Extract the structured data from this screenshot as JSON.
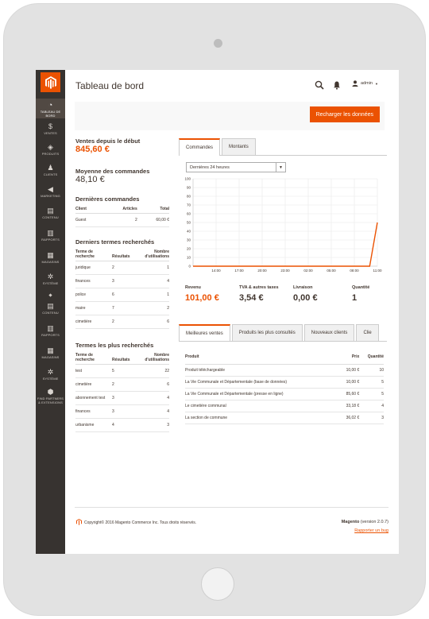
{
  "sidebar": {
    "items": [
      {
        "label": "TABLEAU DE BORD",
        "icon": "dashboard-icon",
        "active": true
      },
      {
        "label": "VENTES",
        "icon": "dollar-icon"
      },
      {
        "label": "PRODUITS",
        "icon": "cube-icon"
      },
      {
        "label": "CLIENTS",
        "icon": "person-icon"
      },
      {
        "label": "MARKETING",
        "icon": "megaphone-icon"
      },
      {
        "label": "CONTENU",
        "icon": "layout-icon"
      },
      {
        "label": "RAPPORTS",
        "icon": "bar-chart-icon"
      },
      {
        "label": "MAGASINS",
        "icon": "store-icon"
      },
      {
        "label": "SYSTÈME",
        "icon": "gear-icon"
      },
      {
        "label": "CONTENU",
        "icon": "layout-icon"
      },
      {
        "label": "RAPPORTS",
        "icon": "bar-chart-icon"
      },
      {
        "label": "MAGASINS",
        "icon": "store-icon"
      },
      {
        "label": "SYSTÈME",
        "icon": "gear-icon"
      },
      {
        "label": "FIND PARTNERS & EXTENSIONS",
        "icon": "box-icon"
      }
    ]
  },
  "header": {
    "title": "Tableau de bord",
    "user": "admin"
  },
  "actions": {
    "reload": "Recharger les données"
  },
  "summary": {
    "lifetime_label": "Ventes depuis le début",
    "lifetime_value": "845,60 €",
    "average_label": "Moyenne des commandes",
    "average_value": "48,10 €"
  },
  "last_orders": {
    "title": "Dernières commandes",
    "headers": [
      "Client",
      "Articles",
      "Total"
    ],
    "rows": [
      [
        "Guest",
        "2",
        "60,00 €"
      ]
    ]
  },
  "last_search": {
    "title": "Derniers termes recherchés",
    "headers": [
      "Terme de recherche",
      "Résultats",
      "Nombre d'utilisations"
    ],
    "rows": [
      [
        "juridique",
        "2",
        "1"
      ],
      [
        "finances",
        "3",
        "4"
      ],
      [
        "police",
        "6",
        "1"
      ],
      [
        "maire",
        "7",
        "2"
      ],
      [
        "cimetière",
        "2",
        "6"
      ]
    ]
  },
  "top_search": {
    "title": "Termes les plus recherchés",
    "headers": [
      "Terme de recherche",
      "Résultats",
      "Nombre d'utilisations"
    ],
    "rows": [
      [
        "test",
        "5",
        "22"
      ],
      [
        "cimetière",
        "2",
        "6"
      ],
      [
        "abonnement test",
        "3",
        "4"
      ],
      [
        "finances",
        "3",
        "4"
      ],
      [
        "urbanisme",
        "4",
        "3"
      ]
    ]
  },
  "chart_tabs": [
    "Commandes",
    "Montants"
  ],
  "period": "Dernières 24 heures",
  "chart_data": {
    "type": "line",
    "x": [
      "14:00",
      "17:00",
      "20:00",
      "23:00",
      "02:00",
      "05:00",
      "08:00",
      "11:00"
    ],
    "series": [
      {
        "values": [
          0,
          0,
          0,
          0,
          0,
          0,
          0,
          0,
          0,
          0,
          0,
          0,
          0,
          0,
          0,
          0,
          0,
          0,
          0,
          0,
          0,
          0,
          0,
          50
        ]
      }
    ],
    "y_ticks": [
      0,
      10,
      20,
      30,
      40,
      50,
      60,
      70,
      80,
      90,
      100
    ],
    "ylim": [
      0,
      100
    ],
    "line_color": "#eb5202",
    "grid": true
  },
  "totals": [
    {
      "label": "Revenu",
      "value": "101,00 €",
      "highlight": true
    },
    {
      "label": "TVA & autres taxes",
      "value": "3,54 €"
    },
    {
      "label": "Livraison",
      "value": "0,00 €"
    },
    {
      "label": "Quantité",
      "value": "1"
    }
  ],
  "product_tabs": [
    "Meilleures ventes",
    "Produits les plus consultés",
    "Nouveaux clients",
    "Clie"
  ],
  "products": {
    "headers": [
      "Produit",
      "Prix",
      "Quantité"
    ],
    "rows": [
      [
        "Produit téléchargeable",
        "10,00 €",
        "10"
      ],
      [
        "La Vie Communale et Départementale (base de données)",
        "10,00 €",
        "5"
      ],
      [
        "La Vie Communale et Départementale (presse en ligne)",
        "85,60 €",
        "5"
      ],
      [
        "Le cimetière communal",
        "33,18 €",
        "4"
      ],
      [
        "La section de commune",
        "36,02 €",
        "3"
      ]
    ]
  },
  "footer": {
    "copyright": "Copyright© 2016 Magento Commerce Inc. Tous droits réservés.",
    "brand": "Magento",
    "version": "(version 2.0.7)",
    "report_bug": "Rapporter un bug"
  },
  "colors": {
    "accent": "#eb5202",
    "sidebar": "#373330"
  }
}
